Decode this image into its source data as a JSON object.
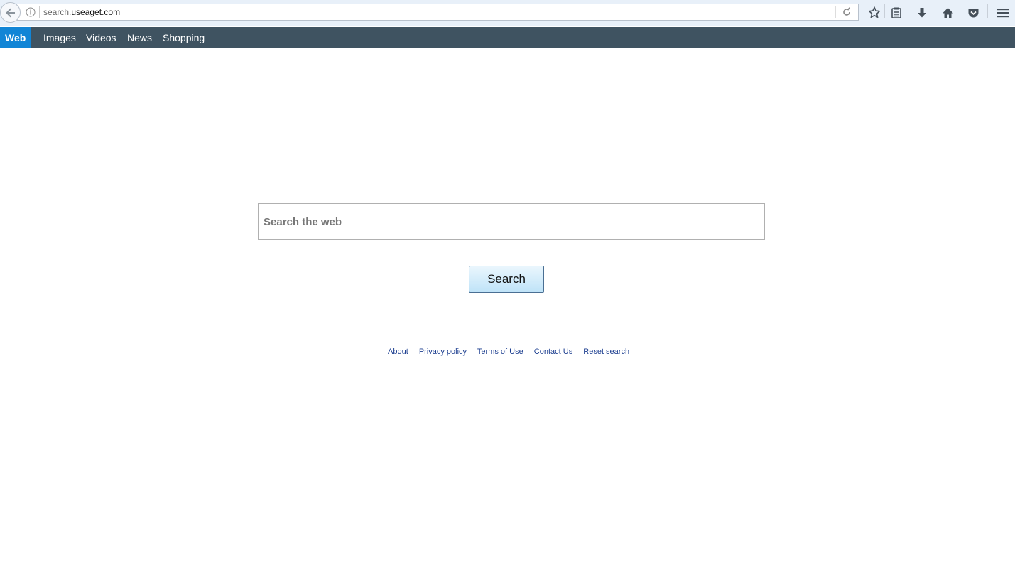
{
  "browser": {
    "url_prefix": "search.",
    "url_domain": "useaget.com",
    "toolbar_icons": [
      "back-icon",
      "info-icon",
      "reload-icon",
      "bookmark-star-icon",
      "reading-list-icon",
      "download-icon",
      "home-icon",
      "pocket-icon",
      "menu-icon"
    ]
  },
  "nav": {
    "items": [
      {
        "label": "Web",
        "active": true
      },
      {
        "label": "Images"
      },
      {
        "label": "Videos"
      },
      {
        "label": "News"
      },
      {
        "label": "Shopping"
      }
    ]
  },
  "search": {
    "placeholder": "Search the web",
    "value": "",
    "button_label": "Search"
  },
  "footer": {
    "links": [
      "About",
      "Privacy policy",
      "Terms of Use",
      "Contact Us",
      "Reset search"
    ]
  },
  "colors": {
    "nav_bg": "#3f5361",
    "nav_active": "#1185d6",
    "link": "#1b3d8f"
  }
}
